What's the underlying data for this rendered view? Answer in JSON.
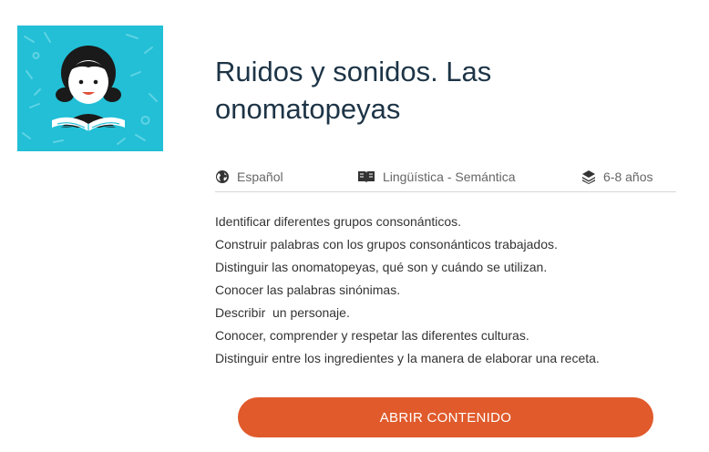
{
  "thumbnail": {
    "icon": "child-reading-icon",
    "background": "#22bfd6"
  },
  "title": "Ruidos y sonidos. Las onomatopeyas",
  "meta": {
    "language": {
      "icon": "globe-icon",
      "label": "Español"
    },
    "subject": {
      "icon": "book-icon",
      "label": "Lingüística - Semántica"
    },
    "age": {
      "icon": "layers-icon",
      "label": "6-8 años"
    }
  },
  "objectives": [
    "Identificar diferentes grupos consonánticos.",
    "Construir palabras con los grupos consonánticos trabajados.",
    "Distinguir las onomatopeyas, qué son y cuándo se utilizan.",
    "Conocer las palabras sinónimas.",
    "Describir  un personaje.",
    "Conocer, comprender y respetar las diferentes culturas.",
    "Distinguir entre los ingredientes y la manera de elaborar una receta."
  ],
  "open_button": {
    "label": "ABRIR CONTENIDO",
    "color": "#e05a2b"
  }
}
